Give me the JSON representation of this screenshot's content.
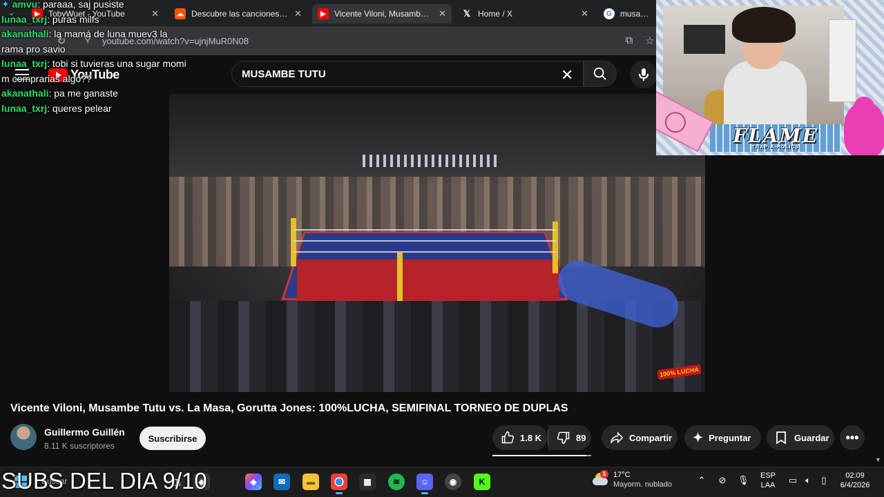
{
  "browser": {
    "tabs": [
      {
        "title": "TobyWuet - YouTube",
        "favicon": "youtube-icon",
        "color": "#ff0000"
      },
      {
        "title": "Descubre las canciones más",
        "favicon": "soundcloud-icon",
        "color": "#ff5500"
      },
      {
        "title": "Vicente Viloni, Musambe Tu",
        "favicon": "youtube-icon",
        "color": "#ff0000",
        "active": true
      },
      {
        "title": "Home / X",
        "favicon": "x-icon",
        "color": "#000000"
      },
      {
        "title": "musambe",
        "favicon": "google-icon",
        "color": "#4285f4"
      }
    ],
    "url": "youtube.com/watch?v=ujnjMuR0N08"
  },
  "youtube": {
    "logo_text": "YouTube",
    "search_value": "MUSAMBE TUTU"
  },
  "chat": [
    {
      "user": "amvu",
      "text": "paraaa, saj pusiste",
      "badge": true
    },
    {
      "user": "lunaa_txrj",
      "text": "puras milfs"
    },
    {
      "user": "akanathali",
      "text": "la mamá de luna muev3 la rama pro savio"
    },
    {
      "user": "lunaa_txrj",
      "text": "tobi si tuvieras una sugar momi m comprarias algo??"
    },
    {
      "user": "akanathali",
      "text": "pa me ganaste"
    },
    {
      "user": "lunaa_txrj",
      "text": "queres pelear"
    }
  ],
  "video": {
    "title": "Vicente Viloni, Musambe Tutu vs. La Masa, Gorutta Jones: 100%LUCHA, SEMIFINAL TORNEO DE DUPLAS",
    "watermark": "100% LUCHA",
    "channel_name": "Guillermo Guillén",
    "subscribers": "8.11 K suscriptores",
    "subscribe_label": "Suscribirse",
    "likes": "1.8 K",
    "dislikes": "89",
    "like_ratio": 0.95,
    "share_label": "Compartir",
    "ask_label": "Preguntar",
    "save_label": "Guardar"
  },
  "webcam": {
    "banner_title": "FLAME",
    "banner_sub": "TRAP-A-HOLICS"
  },
  "overlay": {
    "subs_text": "SUBS DEL DIA 9/10"
  },
  "taskbar": {
    "search_placeholder": "Buscar",
    "weather_temp": "17°C",
    "weather_desc": "Mayorm. nublado",
    "weather_badge": "1",
    "lang_top": "ESP",
    "lang_bottom": "LAA",
    "time": "02:09",
    "date": "6/4/2026"
  }
}
